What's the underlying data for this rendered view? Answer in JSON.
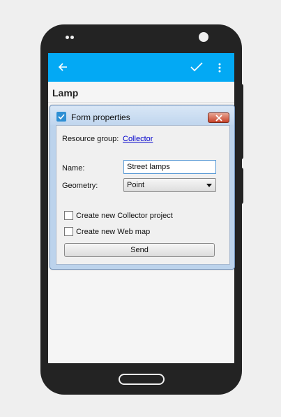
{
  "app": {
    "page_title": "Lamp",
    "colors": {
      "appbar": "#03a9f4",
      "dialog_frame": "#bcd3ec",
      "close_button": "#c7432b"
    },
    "icons": {
      "back": "back-arrow-icon",
      "confirm": "check-icon",
      "menu": "more-vert-icon"
    }
  },
  "dialog": {
    "title": "Form properties",
    "resource_group_label": "Resource group:",
    "resource_group_value": "Collector",
    "name_label": "Name:",
    "name_value": "Street lamps",
    "geometry_label": "Geometry:",
    "geometry_value": "Point",
    "create_collector_label": "Create new Collector project",
    "create_collector_checked": false,
    "create_webmap_label": "Create new Web map",
    "create_webmap_checked": false,
    "send_label": "Send"
  }
}
